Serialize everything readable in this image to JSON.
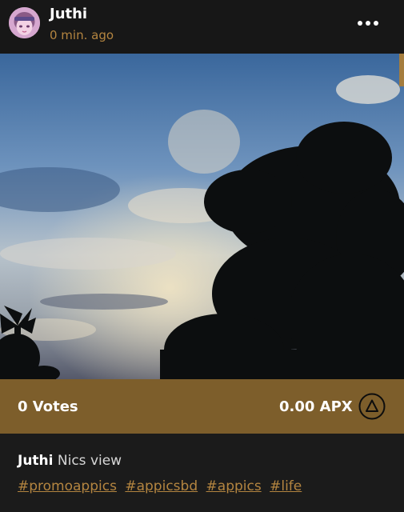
{
  "post": {
    "user_name": "Juthi",
    "time_ago": "0 min. ago"
  },
  "icons": {
    "more": "more-horizontal-icon",
    "vote": "triangle-vote-icon"
  },
  "stats": {
    "votes": "0 Votes",
    "apx": "0.00 APX"
  },
  "caption": {
    "user": "Juthi",
    "text": "Nics view",
    "hashtags": [
      "#promoappics",
      "#appicsbd",
      "#appics",
      "#life"
    ]
  },
  "colors": {
    "accent": "#b48540",
    "vote_bar": "#7d5e2b",
    "background": "#1b1b1b",
    "header": "#171717"
  }
}
